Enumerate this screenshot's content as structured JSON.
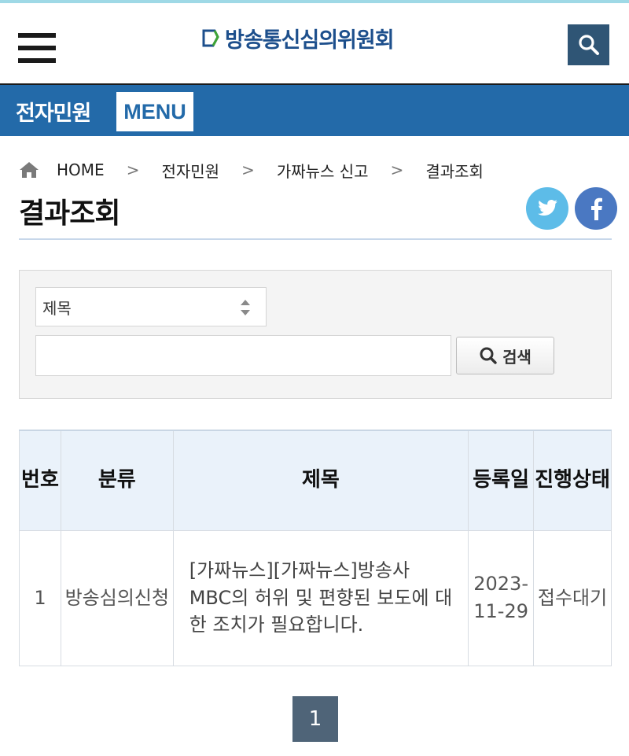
{
  "header": {
    "logo_text": "방송통신심의위원회",
    "menu_icon": "hamburger-menu-icon",
    "search_icon": "search-icon"
  },
  "bar": {
    "title": "전자민원",
    "menu_label": "MENU"
  },
  "breadcrumb": {
    "home_icon": "home-icon",
    "items": [
      "HOME",
      "전자민원",
      "가짜뉴스 신고",
      "결과조회"
    ],
    "separator": ">"
  },
  "page_title": "결과조회",
  "social": {
    "twitter_icon": "twitter-icon",
    "facebook_icon": "facebook-icon"
  },
  "search": {
    "select_value": "제목",
    "input_value": "",
    "button_label": "검색"
  },
  "table": {
    "headers": [
      "번호",
      "분류",
      "제목",
      "등록일",
      "진행상태"
    ],
    "rows": [
      {
        "no": "1",
        "category": "방송심의신청",
        "title": "[가짜뉴스][가짜뉴스]방송사 MBC의 허위 및 편향된 보도에 대한 조치가 필요합니다.",
        "date": "2023-11-29",
        "status": "접수대기"
      }
    ]
  },
  "pagination": {
    "current": "1"
  },
  "colors": {
    "brand_blue": "#236aa9",
    "dark_button": "#2f5575",
    "page_button": "#4f6478",
    "twitter": "#5dbce8",
    "facebook": "#4a78c2"
  }
}
